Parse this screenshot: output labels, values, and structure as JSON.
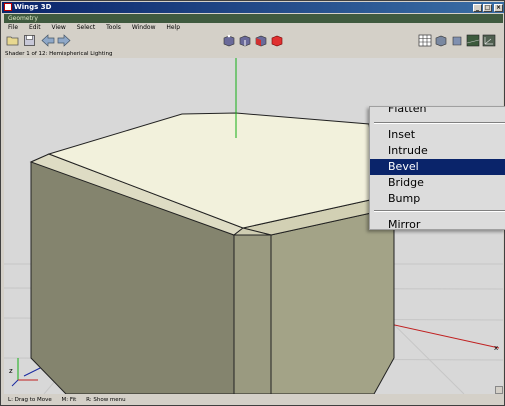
{
  "window": {
    "title": "Wings 3D",
    "minimize": "_",
    "maximize": "□",
    "close": "×"
  },
  "geometry_title": "Geometry",
  "menubar": [
    "File",
    "Edit",
    "View",
    "Select",
    "Tools",
    "Window",
    "Help"
  ],
  "toolbar": {
    "left_icons": [
      "open-folder-icon",
      "save-icon",
      "undo-arrow-icon",
      "redo-arrow-icon"
    ],
    "mode_icons": [
      "vertex-mode-icon",
      "edge-mode-icon",
      "face-mode-icon",
      "body-mode-icon"
    ],
    "right_icons": [
      "grid-icon",
      "smooth-shaded-icon",
      "ortho-icon",
      "ground-plane-icon",
      "axes-icon"
    ]
  },
  "shader_status": "Shader 1 of 12: Hemispherical Lighting",
  "context_menu": {
    "items": [
      {
        "label": "Flatten",
        "selected": false
      },
      {
        "label": "Inset",
        "selected": false
      },
      {
        "label": "Intrude",
        "selected": false
      },
      {
        "label": "Bevel",
        "selected": true
      },
      {
        "label": "Bridge",
        "selected": false
      },
      {
        "label": "Bump",
        "selected": false
      },
      {
        "label": "Mirror",
        "selected": false
      }
    ]
  },
  "axis_labels": {
    "y": "y",
    "z": "z",
    "x": "x"
  },
  "status_bottom": [
    "L: Drag to Move",
    "M: Fit",
    "R: Show menu"
  ],
  "colors": {
    "selected_bg": "#0a246a",
    "title_bg": "#0a246a",
    "geometry_bar": "#3f5a3f",
    "top_face": "#f2f1dc"
  }
}
